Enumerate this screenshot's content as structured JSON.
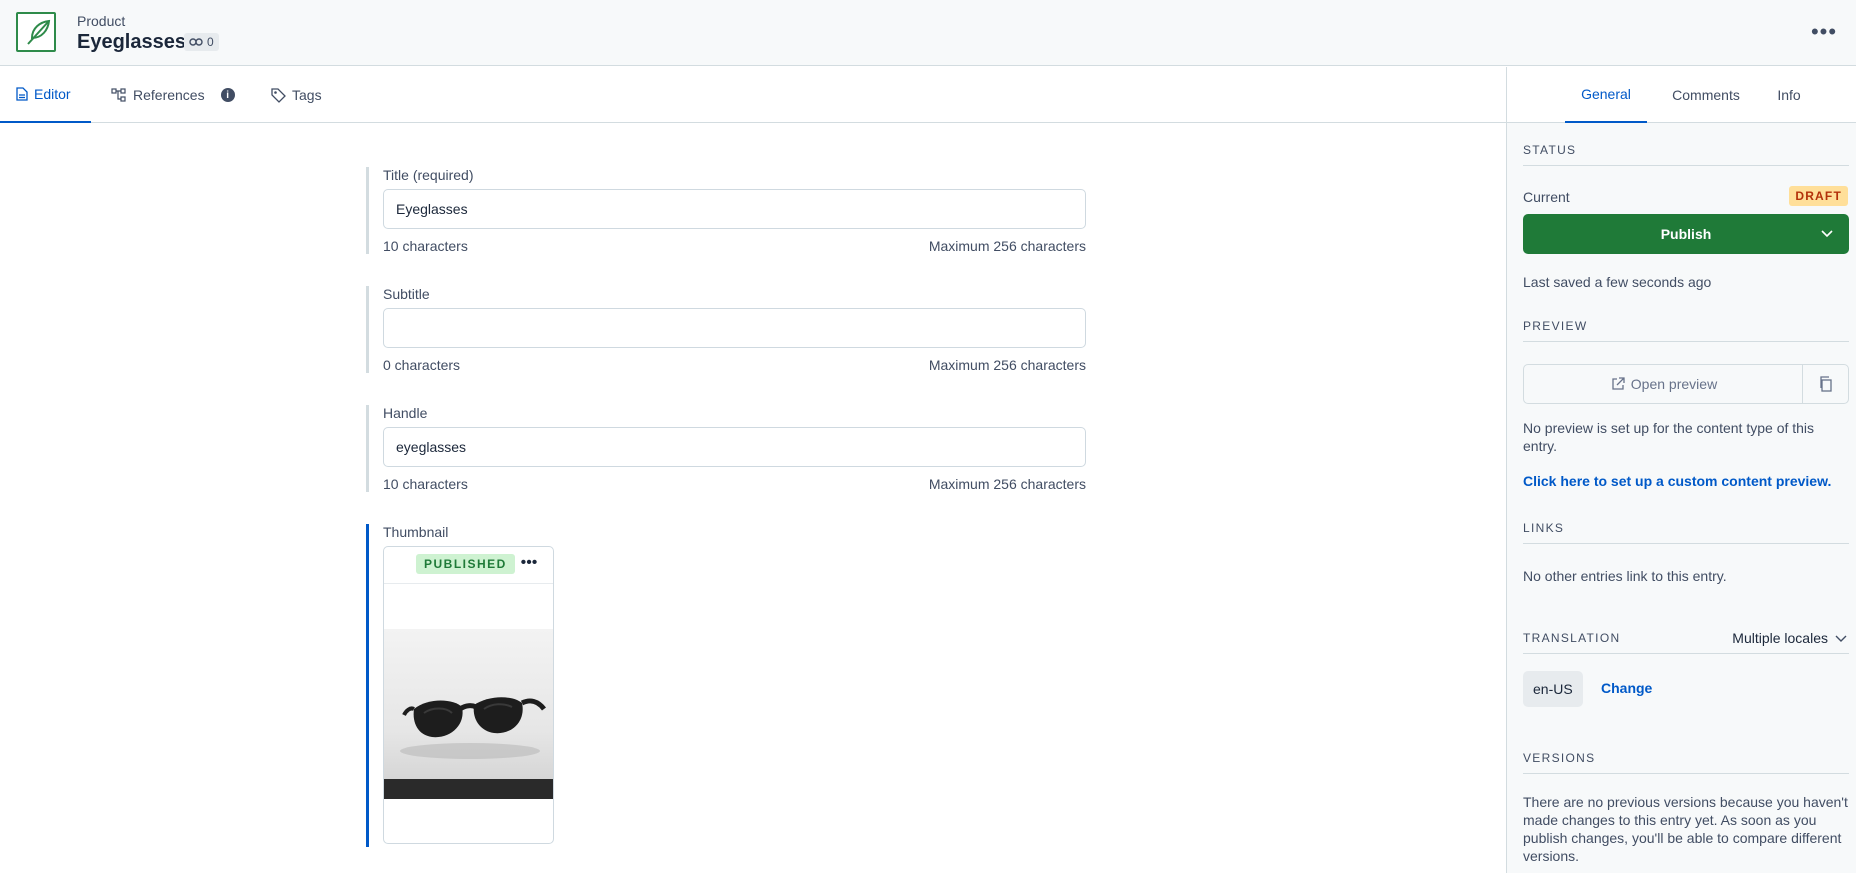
{
  "header": {
    "content_type": "Product",
    "title": "Eyeglasses",
    "link_count": "0"
  },
  "tabs": [
    {
      "label": "Editor",
      "icon": "document-icon",
      "active": true
    },
    {
      "label": "References",
      "icon": "references-icon",
      "active": false
    },
    {
      "label": "Tags",
      "icon": "tag-icon",
      "active": false
    }
  ],
  "fields": {
    "title": {
      "label": "Title (required)",
      "value": "Eyeglasses",
      "count": "10 characters",
      "max": "Maximum 256 characters"
    },
    "subtitle": {
      "label": "Subtitle",
      "value": "",
      "count": "0 characters",
      "max": "Maximum 256 characters"
    },
    "handle": {
      "label": "Handle",
      "value": "eyeglasses",
      "count": "10 characters",
      "max": "Maximum 256 characters"
    },
    "thumbnail": {
      "label": "Thumbnail",
      "status": "PUBLISHED"
    }
  },
  "sidebar": {
    "tabs": [
      "General",
      "Comments",
      "Info"
    ],
    "status": {
      "heading": "STATUS",
      "current_label": "Current",
      "badge": "DRAFT",
      "publish_label": "Publish",
      "last_saved": "Last saved a few seconds ago"
    },
    "preview": {
      "heading": "PREVIEW",
      "open_label": "Open preview",
      "note": "No preview is set up for the content type of this entry.",
      "setup_link": "Click here to set up a custom content preview."
    },
    "links": {
      "heading": "LINKS",
      "note": "No other entries link to this entry."
    },
    "translation": {
      "heading": "TRANSLATION",
      "select": "Multiple locales",
      "locale": "en-US",
      "change_label": "Change"
    },
    "versions": {
      "heading": "VERSIONS",
      "note": "There are no previous versions because you haven't made changes to this entry yet. As soon as you publish changes, you'll be able to compare different versions."
    }
  },
  "colors": {
    "accent": "#0059c8",
    "publish": "#1f7a38",
    "draft_bg": "#ffdf99",
    "published_bg": "#cef2d1"
  }
}
